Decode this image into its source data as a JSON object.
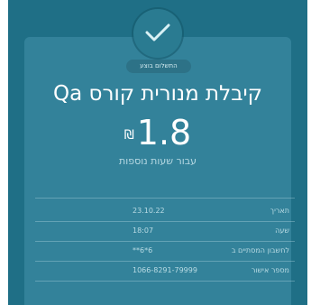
{
  "status_badge": "התשלום בוצע",
  "title": "קיבלת מנורית קורס Qa",
  "amount": "1.8",
  "currency_symbol": "₪",
  "subtitle": "עבור שעות נוספות",
  "details": [
    {
      "label": "תאריך",
      "value": "23.10.22"
    },
    {
      "label": "שעה",
      "value": "18:07"
    },
    {
      "label": "לחשבון המסתיים ב",
      "value": "**6*6"
    },
    {
      "label": "מספר אישור",
      "value": "1066-8291-79999"
    }
  ],
  "colors": {
    "background": "#1f6f86",
    "card": "#33829a",
    "text": "#ffffff",
    "muted_text": "#b9dbe4"
  },
  "icons": {
    "success": "checkmark-icon"
  }
}
